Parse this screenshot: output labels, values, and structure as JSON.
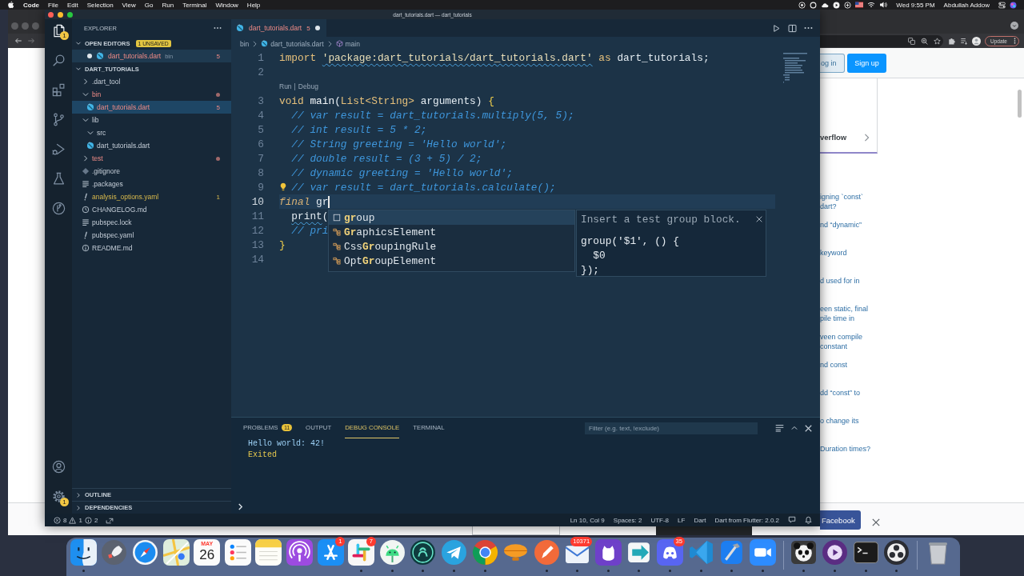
{
  "menu_bar": {
    "app_name": "Code",
    "menus": [
      "File",
      "Edit",
      "Selection",
      "View",
      "Go",
      "Run",
      "Terminal",
      "Window",
      "Help"
    ],
    "clock": "Wed 9:55 PM",
    "user": "Abdullah Addow"
  },
  "browser": {
    "update_button": "Update",
    "page": {
      "login_button": "og in",
      "signup_button": "Sign up",
      "card_link": "verflow",
      "links": [
        {
          "lines": [
            "igning `const`",
            "dart?"
          ]
        },
        {
          "lines": [
            "nd “dynamic”"
          ]
        },
        {
          "lines": [
            "keyword"
          ]
        },
        {
          "lines": [
            "d used for in"
          ]
        },
        {
          "lines": [
            "een static, final",
            "pile time in"
          ]
        },
        {
          "lines": [
            "veen compile",
            "constant"
          ]
        },
        {
          "lines": [
            "nd const"
          ]
        },
        {
          "lines": [
            "dd “const” to"
          ]
        },
        {
          "lines": [
            "o change its"
          ]
        },
        {
          "lines": [
            "Duration times?"
          ]
        }
      ],
      "facebook_button": "Facebook"
    }
  },
  "code_window": {
    "title": "dart_tutorials.dart — dart_tutorials",
    "activity_bar": {
      "items": [
        {
          "kind": "explorer",
          "selected": true,
          "badge": "1"
        },
        {
          "kind": "search",
          "selected": false
        },
        {
          "kind": "extensions",
          "selected": false
        },
        {
          "kind": "source_control",
          "selected": false
        },
        {
          "kind": "run_debug",
          "selected": false
        },
        {
          "kind": "testing",
          "selected": false
        },
        {
          "kind": "remote",
          "selected": false
        }
      ],
      "bottom_items": [
        {
          "kind": "account"
        },
        {
          "kind": "settings",
          "badge": "1"
        }
      ]
    },
    "sidebar": {
      "title": "EXPLORER",
      "open_editors": {
        "title": "OPEN EDITORS",
        "expanded": true,
        "badge": "1 UNSAVED",
        "items": [
          {
            "kind": "dart",
            "name": "dart_tutorials.dart",
            "folder": "bin",
            "problems": "5",
            "has_errors": true,
            "has_warnings": false,
            "modified": true,
            "selected": true
          }
        ]
      },
      "project": {
        "title": "DART_TUTORIALS",
        "expanded": true,
        "tree": [
          {
            "kind": "folder",
            "name": ".dart_tool",
            "has_errors": false,
            "has_warnings": false,
            "expanded": false,
            "selected": false
          },
          {
            "kind": "folder",
            "name": "bin",
            "has_errors": true,
            "has_warnings": false,
            "expanded": true,
            "selected": false,
            "children": [
              {
                "kind": "dart",
                "name": "dart_tutorials.dart",
                "has_errors": true,
                "has_warnings": false,
                "problems": "5",
                "selected": true
              }
            ]
          },
          {
            "kind": "folder",
            "name": "lib",
            "has_errors": false,
            "has_warnings": false,
            "expanded": true,
            "selected": false,
            "children": [
              {
                "kind": "folder",
                "name": "src",
                "has_errors": false,
                "has_warnings": false,
                "expanded": true,
                "selected": false
              },
              {
                "kind": "dart",
                "name": "dart_tutorials.dart",
                "has_errors": false,
                "has_warnings": false,
                "selected": false
              }
            ]
          },
          {
            "kind": "folder",
            "name": "test",
            "has_errors": true,
            "has_warnings": false,
            "expanded": false,
            "selected": false
          },
          {
            "kind": "git",
            "name": ".gitignore",
            "has_errors": false,
            "has_warnings": false,
            "selected": false
          },
          {
            "kind": "lines",
            "name": ".packages",
            "has_errors": false,
            "has_warnings": false,
            "selected": false
          },
          {
            "kind": "yaml",
            "name": "analysis_options.yaml",
            "has_errors": false,
            "has_warnings": true,
            "problems": "1",
            "selected": false
          },
          {
            "kind": "changelog",
            "name": "CHANGELOG.md",
            "has_errors": false,
            "has_warnings": false,
            "selected": false
          },
          {
            "kind": "lines",
            "name": "pubspec.lock",
            "has_errors": false,
            "has_warnings": false,
            "selected": false
          },
          {
            "kind": "yaml",
            "name": "pubspec.yaml",
            "has_errors": false,
            "has_warnings": false,
            "selected": false
          },
          {
            "kind": "info",
            "name": "README.md",
            "has_errors": false,
            "has_warnings": false,
            "selected": false
          }
        ]
      },
      "bottom_sections": [
        {
          "title": "OUTLINE",
          "expanded": false
        },
        {
          "title": "DEPENDENCIES",
          "expanded": false
        }
      ]
    },
    "editor": {
      "tabs": [
        {
          "kind": "dart",
          "label": "dart_tutorials.dart",
          "problems": "5",
          "has_errors": true,
          "has_warnings": false,
          "modified": true,
          "selected": true
        }
      ],
      "breadcrumbs": [
        {
          "kind": "folder",
          "label": "bin"
        },
        {
          "kind": "dart",
          "label": "dart_tutorials.dart"
        },
        {
          "kind": "method",
          "label": "main"
        }
      ],
      "lines": [
        {
          "kind": "code",
          "number": "1",
          "current": false,
          "lightbulb": false,
          "tokens": [
            {
              "text": "import ",
              "kind": "keyword"
            },
            {
              "text": "'package:dart_tutorials/dart_tutorials.dart'",
              "kind": "string",
              "squiggle": true
            },
            {
              "text": " as ",
              "kind": "keyword"
            },
            {
              "text": "dart_tutorials;",
              "kind": "plain"
            }
          ]
        },
        {
          "kind": "code",
          "number": "2",
          "current": false,
          "lightbulb": false
        },
        {
          "kind": "codelens",
          "actions": [
            "Run",
            "Debug"
          ],
          "separator": "|"
        },
        {
          "kind": "code",
          "number": "3",
          "current": false,
          "lightbulb": false,
          "tokens": [
            {
              "text": "void ",
              "kind": "keyword"
            },
            {
              "text": "main",
              "kind": "function"
            },
            {
              "text": "(",
              "kind": "plain"
            },
            {
              "text": "List<String>",
              "kind": "type"
            },
            {
              "text": " arguments) ",
              "kind": "plain"
            },
            {
              "text": "{",
              "kind": "bracket"
            }
          ]
        },
        {
          "kind": "code",
          "number": "4",
          "current": false,
          "lightbulb": false,
          "tokens": [
            {
              "text": "  // var result = dart_tutorials.multiply(5, 5);",
              "kind": "comment"
            }
          ]
        },
        {
          "kind": "code",
          "number": "5",
          "current": false,
          "lightbulb": false,
          "tokens": [
            {
              "text": "  // int result = 5 * 2;",
              "kind": "comment"
            }
          ]
        },
        {
          "kind": "code",
          "number": "6",
          "current": false,
          "lightbulb": false,
          "tokens": [
            {
              "text": "  // String greeting = 'Hello world';",
              "kind": "comment"
            }
          ]
        },
        {
          "kind": "code",
          "number": "7",
          "current": false,
          "lightbulb": false,
          "tokens": [
            {
              "text": "  // double result = (3 + 5) / 2;",
              "kind": "comment"
            }
          ]
        },
        {
          "kind": "code",
          "number": "8",
          "current": false,
          "lightbulb": false,
          "tokens": [
            {
              "text": "  // dynamic greeting = 'Hello world';",
              "kind": "comment"
            }
          ]
        },
        {
          "kind": "code",
          "number": "9",
          "current": false,
          "lightbulb": true,
          "tokens": [
            {
              "text": "  // var result = dart_tutorials.calculate();",
              "kind": "comment"
            }
          ]
        },
        {
          "kind": "code",
          "number": "10",
          "current": true,
          "lightbulb": false,
          "tokens": [
            {
              "text": "final",
              "kind": "storage"
            },
            {
              "text": " gr",
              "kind": "plain"
            }
          ]
        },
        {
          "kind": "code",
          "number": "11",
          "current": false,
          "lightbulb": false,
          "tokens": [
            {
              "text": "  print",
              "kind": "plain",
              "squiggle": true
            },
            {
              "text": "(",
              "kind": "plain"
            }
          ]
        },
        {
          "kind": "code",
          "number": "12",
          "current": false,
          "lightbulb": false,
          "tokens": [
            {
              "text": "  // pri",
              "kind": "comment"
            }
          ]
        },
        {
          "kind": "code",
          "number": "13",
          "current": false,
          "lightbulb": false,
          "tokens": [
            {
              "text": "}",
              "kind": "bracket"
            }
          ]
        },
        {
          "kind": "code",
          "number": "14",
          "current": false,
          "lightbulb": false
        }
      ],
      "suggestions": {
        "items": [
          {
            "kind": "snippet",
            "label": "**gr**oup",
            "selected": true
          },
          {
            "kind": "class",
            "label": "**Gr**aphicsElement",
            "selected": false
          },
          {
            "kind": "class",
            "label": "Css**Gr**oupingRule",
            "selected": false
          },
          {
            "kind": "class",
            "label": "Opt**Gr**oupElement",
            "selected": false
          }
        ],
        "details": {
          "description": "Insert a test group block.",
          "code": [
            "group('$1', () {",
            "  $0",
            "});"
          ]
        }
      }
    },
    "panel": {
      "tabs": [
        {
          "label": "PROBLEMS",
          "badge": "11",
          "selected": false
        },
        {
          "label": "OUTPUT",
          "selected": false
        },
        {
          "label": "DEBUG CONSOLE",
          "selected": true
        },
        {
          "label": "TERMINAL",
          "selected": false
        }
      ],
      "filter": {
        "placeholder": "Filter (e.g. text, !exclude)"
      },
      "console": [
        {
          "kind": "output",
          "text": "Hello world: 42!"
        },
        {
          "kind": "status",
          "text": "Exited"
        }
      ]
    },
    "status_bar": {
      "errors": "8",
      "warnings": "1",
      "infos": "2",
      "items": [
        "Ln 10, Col 9",
        "Spaces: 2",
        "UTF-8",
        "LF",
        "Dart",
        "Dart from Flutter: 2.0.2"
      ]
    }
  },
  "dock": {
    "sections": [
      {
        "apps": [
          {
            "kind": "finder",
            "running": true
          },
          {
            "kind": "launchpad",
            "running": false
          },
          {
            "kind": "safari",
            "running": false
          },
          {
            "kind": "maps",
            "running": false
          },
          {
            "kind": "calendar",
            "month": "MAY",
            "day": "26",
            "running": false
          },
          {
            "kind": "reminders",
            "running": false
          },
          {
            "kind": "notes",
            "running": false
          },
          {
            "kind": "podcasts",
            "running": false
          },
          {
            "kind": "app_store",
            "badge": "1",
            "running": false
          },
          {
            "kind": "slack",
            "badge": "7",
            "running": true
          },
          {
            "kind": "android_studio",
            "running": true
          },
          {
            "kind": "gitkraken",
            "running": true
          },
          {
            "kind": "telegram",
            "running": true
          },
          {
            "kind": "chrome",
            "running": true
          },
          {
            "kind": "airship",
            "running": false
          },
          {
            "kind": "pen",
            "running": true
          },
          {
            "kind": "mail",
            "badge": "10371",
            "running": true
          },
          {
            "kind": "github",
            "running": true
          },
          {
            "kind": "transfer",
            "running": true
          },
          {
            "kind": "discord",
            "badge": "35",
            "running": true
          },
          {
            "kind": "vscode",
            "running": true
          },
          {
            "kind": "xcode",
            "running": true
          },
          {
            "kind": "zoom",
            "running": true
          }
        ]
      },
      {
        "apps": [
          {
            "kind": "panda",
            "running": true
          },
          {
            "kind": "player",
            "running": true
          },
          {
            "kind": "terminal",
            "running": true
          },
          {
            "kind": "obs",
            "running": true
          }
        ]
      },
      {
        "apps": [
          {
            "kind": "trash",
            "running": false
          }
        ]
      }
    ]
  }
}
